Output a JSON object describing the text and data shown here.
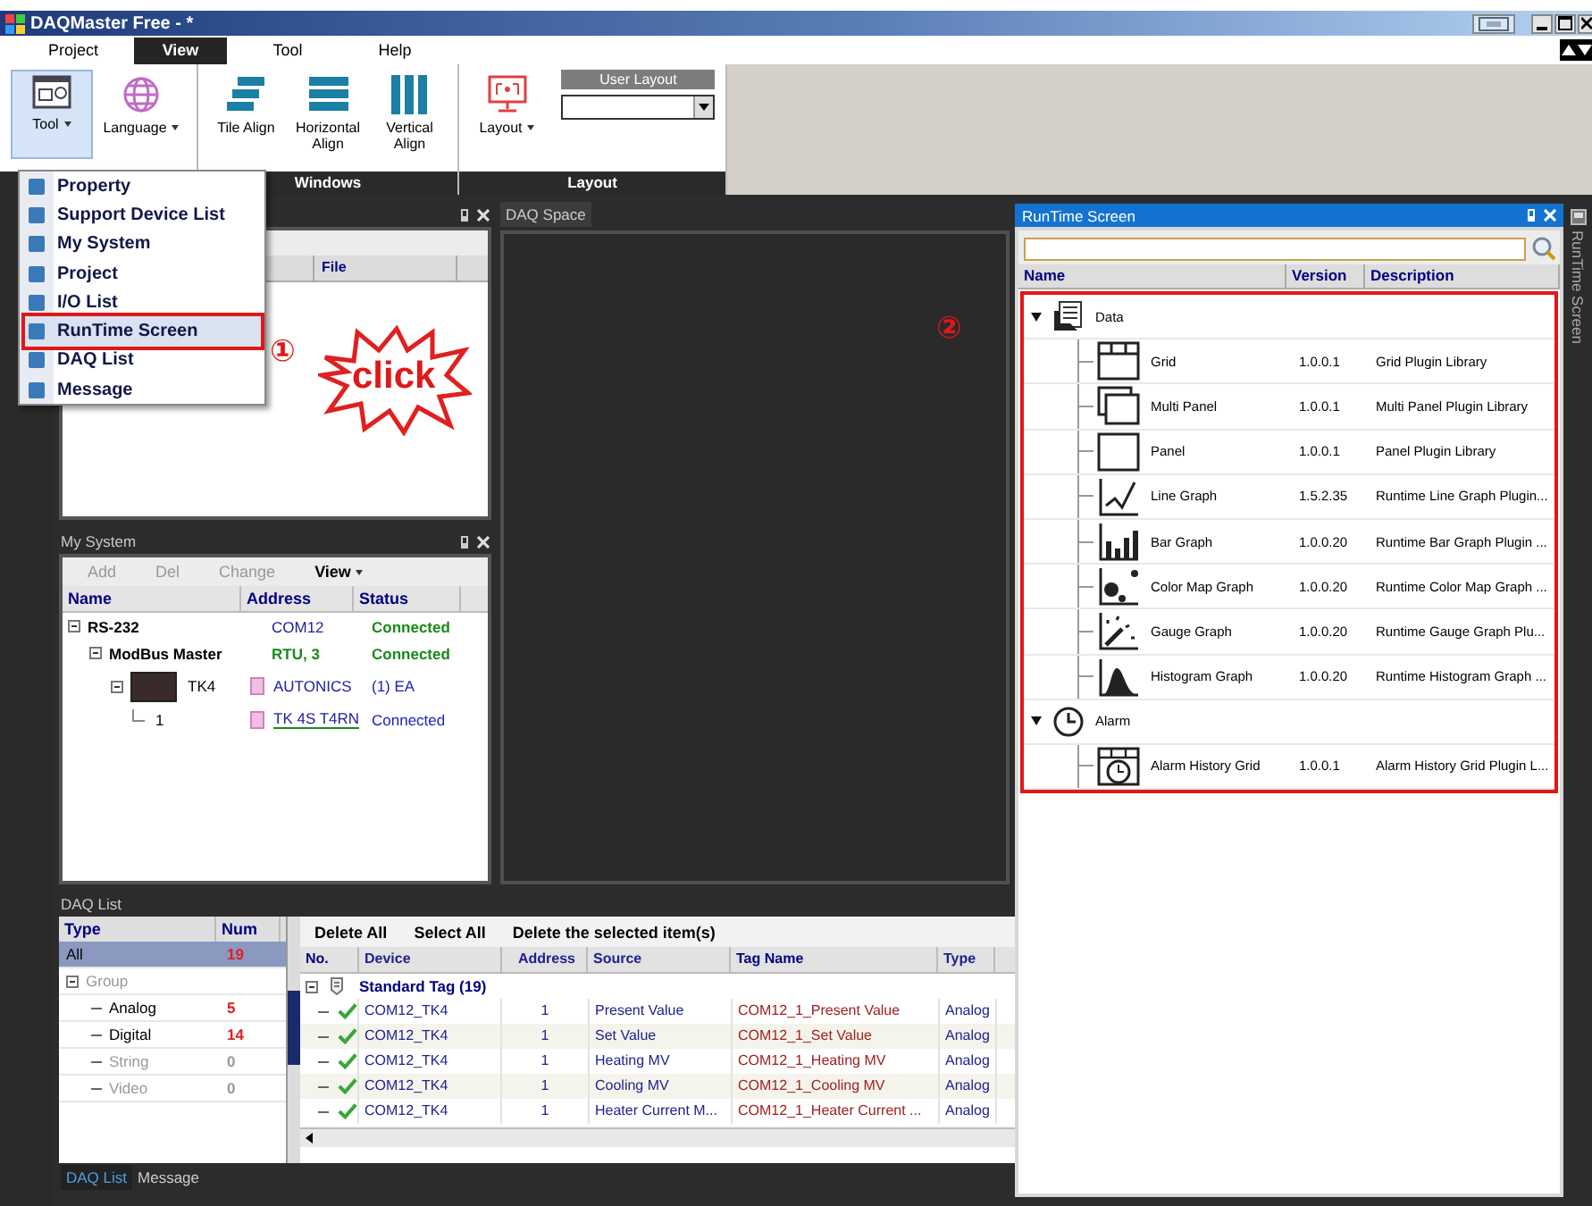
{
  "window": {
    "title": "DAQMaster Free - *"
  },
  "ribbon": {
    "tabs": [
      {
        "label": "Project",
        "selected": false
      },
      {
        "label": "View",
        "selected": true
      },
      {
        "label": "Tool",
        "selected": false
      },
      {
        "label": "Help",
        "selected": false
      }
    ],
    "groups": [
      {
        "buttons": [
          {
            "kind": "tool",
            "label": "Tool",
            "has_menu": true,
            "selected": true
          },
          {
            "kind": "language",
            "label": "Language",
            "has_menu": true,
            "selected": false
          }
        ]
      },
      {
        "label": "Windows",
        "buttons": [
          {
            "kind": "tile",
            "label": "Tile Align",
            "has_menu": false,
            "selected": false
          },
          {
            "kind": "horizontal",
            "label": "Horizontal Align",
            "has_menu": false,
            "selected": false
          },
          {
            "kind": "vertical",
            "label": "Vertical Align",
            "has_menu": false,
            "selected": false
          }
        ]
      },
      {
        "label": "Layout",
        "buttons": [
          {
            "kind": "layout",
            "label": "Layout",
            "has_menu": true,
            "selected": false
          }
        ],
        "combo": {
          "label": "User Layout"
        }
      }
    ]
  },
  "menu": {
    "items": [
      {
        "label": "Property",
        "selected": false
      },
      {
        "label": "Support Device List",
        "selected": false
      },
      {
        "label": "My System",
        "selected": false
      },
      {
        "label": "Project",
        "selected": false
      },
      {
        "label": "I/O List",
        "selected": false
      },
      {
        "label": "RunTime Screen",
        "selected": true
      },
      {
        "label": "DAQ List",
        "selected": false
      },
      {
        "label": "Message",
        "selected": false
      }
    ]
  },
  "project_panel": {
    "column": "File"
  },
  "daq_space": {
    "tab": "DAQ Space"
  },
  "my_system": {
    "title": "My System",
    "toolbar": [
      {
        "label": "Add",
        "disabled": true
      },
      {
        "label": "Del",
        "disabled": true
      },
      {
        "label": "Change",
        "disabled": true
      },
      {
        "label": "View",
        "disabled": false
      }
    ],
    "columns": [
      "Name",
      "Address",
      "Status"
    ],
    "tree": [
      {
        "name": "RS-232",
        "address": "COM12",
        "status": "Connected",
        "expanded": true,
        "children": [
          {
            "name": "ModBus Master",
            "address": "RTU, 3",
            "status": "Connected",
            "expanded": true,
            "children": [
              {
                "name": "TK4",
                "address": "AUTONICS",
                "status": "(1) EA",
                "expanded": true,
                "children": [
                  {
                    "name": "1",
                    "address": "TK 4S T4RN",
                    "status": "Connected"
                  }
                ]
              }
            ]
          }
        ]
      }
    ]
  },
  "daq_list": {
    "title": "DAQ List",
    "type_columns": [
      "Type",
      "Num"
    ],
    "types": [
      {
        "label": "All",
        "num": "19",
        "selected": true,
        "disabled": false
      },
      {
        "label": "Group",
        "selected": false,
        "disabled": true,
        "expanded": true,
        "children": [
          {
            "label": "Analog",
            "num": "5",
            "selected": false,
            "disabled": false
          },
          {
            "label": "Digital",
            "num": "14",
            "selected": false,
            "disabled": false
          },
          {
            "label": "String",
            "num": "0",
            "selected": false,
            "disabled": true
          },
          {
            "label": "Video",
            "num": "0",
            "selected": false,
            "disabled": true
          }
        ]
      }
    ],
    "toolbar": [
      "Delete All",
      "Select All",
      "Delete the selected item(s)"
    ],
    "columns": [
      "No.",
      "Device",
      "Address",
      "Source",
      "Tag Name",
      "Type"
    ],
    "group": "Standard Tag (19)",
    "rows": [
      {
        "checked": true,
        "device": "COM12_TK4",
        "address": "1",
        "source": "Present Value",
        "tag_name": "COM12_1_Present Value",
        "type": "Analog"
      },
      {
        "checked": true,
        "device": "COM12_TK4",
        "address": "1",
        "source": "Set Value",
        "tag_name": "COM12_1_Set Value",
        "type": "Analog"
      },
      {
        "checked": true,
        "device": "COM12_TK4",
        "address": "1",
        "source": "Heating MV",
        "tag_name": "COM12_1_Heating MV",
        "type": "Analog"
      },
      {
        "checked": true,
        "device": "COM12_TK4",
        "address": "1",
        "source": "Cooling MV",
        "tag_name": "COM12_1_Cooling MV",
        "type": "Analog"
      },
      {
        "checked": true,
        "device": "COM12_TK4",
        "address": "1",
        "source": "Heater Current M...",
        "tag_name": "COM12_1_Heater Current ...",
        "type": "Analog"
      }
    ],
    "tabs": [
      {
        "label": "DAQ List",
        "selected": true
      },
      {
        "label": "Message",
        "selected": false
      }
    ]
  },
  "runtime": {
    "title": "RunTime Screen",
    "columns": [
      "Name",
      "Version",
      "Description"
    ],
    "tree": [
      {
        "kind": "data",
        "name": "Data",
        "expanded": true,
        "children": [
          {
            "kind": "grid",
            "name": "Grid",
            "version": "1.0.0.1",
            "description": "Grid Plugin Library"
          },
          {
            "kind": "multi_panel",
            "name": "Multi Panel",
            "version": "1.0.0.1",
            "description": "Multi Panel Plugin Library"
          },
          {
            "kind": "panel",
            "name": "Panel",
            "version": "1.0.0.1",
            "description": "Panel Plugin Library"
          },
          {
            "kind": "line",
            "name": "Line Graph",
            "version": "1.5.2.35",
            "description": "Runtime Line Graph Plugin..."
          },
          {
            "kind": "bar",
            "name": "Bar Graph",
            "version": "1.0.0.20",
            "description": "Runtime Bar Graph Plugin ..."
          },
          {
            "kind": "color_map",
            "name": "Color Map Graph",
            "version": "1.0.0.20",
            "description": "Runtime Color Map Graph ..."
          },
          {
            "kind": "gauge",
            "name": "Gauge Graph",
            "version": "1.0.0.20",
            "description": "Runtime Gauge Graph Plu..."
          },
          {
            "kind": "histogram",
            "name": "Histogram Graph",
            "version": "1.0.0.20",
            "description": "Runtime Histogram Graph ..."
          }
        ]
      },
      {
        "kind": "alarm",
        "name": "Alarm",
        "expanded": true,
        "children": [
          {
            "kind": "alarm_grid",
            "name": "Alarm History Grid",
            "version": "1.0.0.1",
            "description": "Alarm History Grid Plugin L..."
          }
        ]
      }
    ],
    "side_tab": "RunTime Screen"
  },
  "annotations": {
    "step_1": "①",
    "click": "click",
    "step_2": "②"
  }
}
